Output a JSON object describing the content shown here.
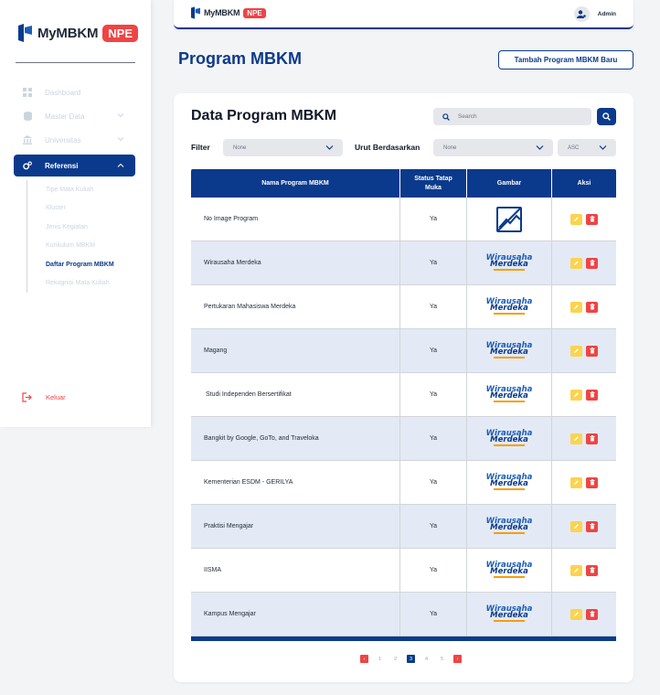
{
  "brand": {
    "name": "MyMBKM",
    "badge": "NPE"
  },
  "sidebar": {
    "items": [
      {
        "label": "Dashboard",
        "icon": "dashboard-icon"
      },
      {
        "label": "Master Data",
        "icon": "database-icon"
      },
      {
        "label": "Universitas",
        "icon": "university-icon"
      },
      {
        "label": "Referensi",
        "icon": "gears-icon"
      }
    ],
    "submenu": [
      "Tipe Mata Kuliah",
      "Kluster",
      "Jenis Kegiatan",
      "Kurikulum MBKM",
      "Daftar Program MBKM",
      "Rekognisi Mata Kuliah"
    ],
    "logout": "Keluar"
  },
  "header": {
    "user": "Admin"
  },
  "page": {
    "title": "Program MBKM",
    "add_button": "Tambah Program MBKM Baru"
  },
  "card": {
    "title": "Data Program MBKM",
    "search_placeholder": "Search",
    "filter_label": "Filter",
    "filter_value": "None",
    "sort_label": "Urut Berdasarkan",
    "sort_value": "None",
    "order_value": "ASC"
  },
  "table": {
    "headers": [
      "Nama Program MBKM",
      "Status Tatap Muka",
      "Gambar",
      "Aksi"
    ],
    "rows": [
      {
        "name": "No Image Program",
        "status": "Ya",
        "image": "no-image"
      },
      {
        "name": "Wirausaha Merdeka",
        "status": "Ya",
        "image": "logo"
      },
      {
        "name": "Pertukaran Mahasiswa Merdeka",
        "status": "Ya",
        "image": "logo"
      },
      {
        "name": "Magang",
        "status": "Ya",
        "image": "logo"
      },
      {
        "name": " Studi Independen Bersertifikat",
        "status": "Ya",
        "image": "logo"
      },
      {
        "name": "Bangkit by Google, GoTo, and Traveloka",
        "status": "Ya",
        "image": "logo"
      },
      {
        "name": "Kementerian ESDM - GERILYA",
        "status": "Ya",
        "image": "logo"
      },
      {
        "name": "Praktisi Mengajar",
        "status": "Ya",
        "image": "logo"
      },
      {
        "name": "IISMA",
        "status": "Ya",
        "image": "logo"
      },
      {
        "name": "Kampus Mengajar",
        "status": "Ya",
        "image": "logo"
      }
    ],
    "logo_text": {
      "line1": "Wirausaha",
      "line2": "Merdeka"
    }
  },
  "pagination": {
    "pages": [
      "1",
      "2",
      "3",
      "4",
      "5"
    ],
    "current": "3"
  },
  "colors": {
    "primary": "#0b3a8c",
    "danger": "#ef4444",
    "warning": "#fcd34d",
    "row_alt": "#e3eaf5"
  }
}
